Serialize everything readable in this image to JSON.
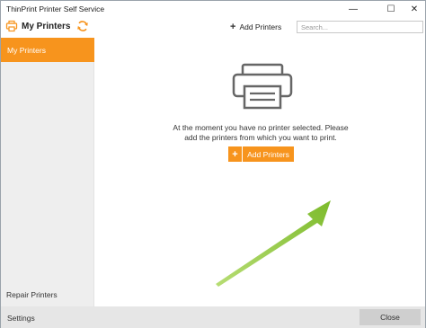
{
  "window": {
    "title": "ThinPrint Printer Self Service",
    "minimize_glyph": "—",
    "maximize_glyph": "☐",
    "close_glyph": "✕"
  },
  "header": {
    "page_title": "My Printers",
    "app_icon": "printer-icon",
    "refresh_icon": "refresh-icon",
    "add_printers_plus": "+",
    "add_printers_label": "Add Printers",
    "search_placeholder": "Search..."
  },
  "sidebar": {
    "items": [
      {
        "label": "My Printers",
        "active": true
      },
      {
        "label": "Repair Printers",
        "active": false
      }
    ]
  },
  "main": {
    "illustration_icon": "printer-icon",
    "message": "At the moment you have no printer selected. Please add the printers from which you want to print.",
    "add_button_plus": "+",
    "add_button_label": "Add Printers",
    "annotation": "green-arrow"
  },
  "footer": {
    "settings_label": "Settings",
    "close_label": "Close"
  },
  "colors": {
    "accent": "#f7941d",
    "arrow": "#8cc63f",
    "sidebar_bg": "#eeeeee",
    "footer_bg": "#e6e6e6"
  }
}
